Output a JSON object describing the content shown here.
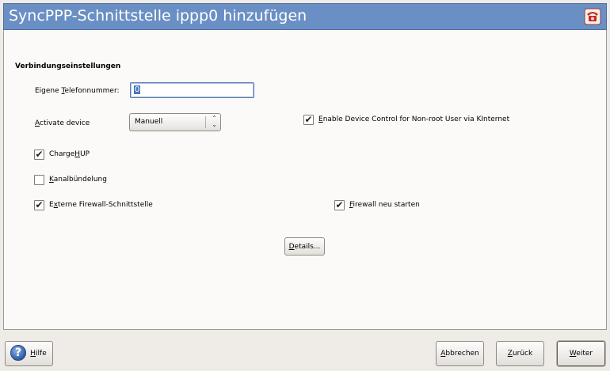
{
  "window": {
    "title": "SyncPPP-Schnittstelle ippp0 hinzufügen",
    "icon": "red-telephone-icon"
  },
  "section": {
    "title": "Verbindungseinstellungen"
  },
  "fields": {
    "own_phone": {
      "label_pre": "Eigene ",
      "label_mnemonic": "T",
      "label_post": "elefonnummer:",
      "value": "0"
    },
    "activate_device": {
      "label_pre": "",
      "label_mnemonic": "A",
      "label_post": "ctivate device",
      "selected": "Manuell"
    }
  },
  "checkboxes": {
    "device_control": {
      "label_pre": "",
      "label_mnemonic": "E",
      "label_post": "nable Device Control for Non-root User via KInternet",
      "checked": true
    },
    "chargehup": {
      "label_pre": "Charge",
      "label_mnemonic": "H",
      "label_post": "UP",
      "checked": true
    },
    "channel_bundling": {
      "label_pre": "",
      "label_mnemonic": "K",
      "label_post": "analbündelung",
      "checked": false
    },
    "external_firewall": {
      "label_pre": "E",
      "label_mnemonic": "x",
      "label_post": "terne Firewall-Schnittstelle",
      "checked": true
    },
    "restart_firewall": {
      "label_pre": "",
      "label_mnemonic": "F",
      "label_post": "irewall neu starten",
      "checked": true
    }
  },
  "buttons": {
    "details": {
      "label_pre": "",
      "label_mnemonic": "D",
      "label_post": "etails..."
    },
    "help": {
      "label_pre": "",
      "label_mnemonic": "H",
      "label_post": "ilfe"
    },
    "cancel": {
      "label_pre": "",
      "label_mnemonic": "A",
      "label_post": "bbrechen"
    },
    "back": {
      "label_pre": "",
      "label_mnemonic": "Z",
      "label_post": "urück"
    },
    "next": {
      "label_pre": "",
      "label_mnemonic": "W",
      "label_post": "eiter"
    }
  },
  "colors": {
    "titlebar": "#6a8fc4",
    "content_bg": "#fbfaf8",
    "window_bg": "#efebe7",
    "focus_border": "#5b7cb0"
  }
}
